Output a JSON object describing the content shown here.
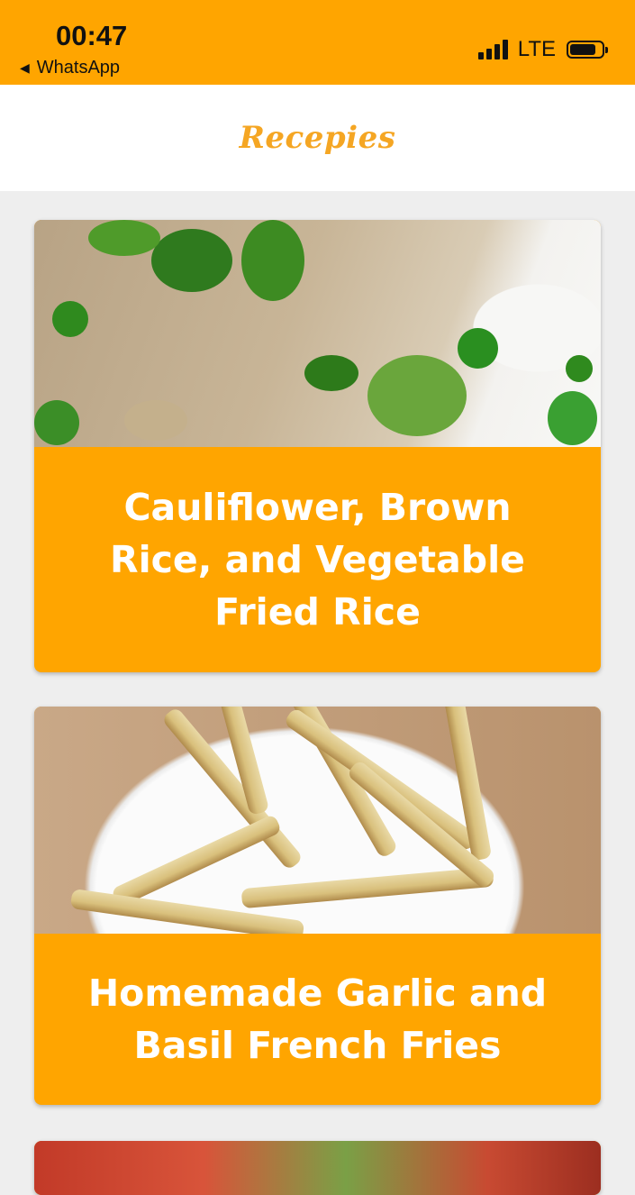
{
  "status_bar": {
    "time": "00:47",
    "back_app": "WhatsApp",
    "network": "LTE",
    "back_icon": "back-triangle-icon",
    "signal_icon": "signal-bars-icon",
    "battery_icon": "battery-icon"
  },
  "header": {
    "title": "Recepies",
    "color": "#f5a623"
  },
  "colors": {
    "accent": "#ffa500",
    "background": "#eeeeee"
  },
  "recipes": [
    {
      "title": "Cauliflower, Brown Rice, and Vegetable Fried Rice",
      "image": "fried-rice-photo"
    },
    {
      "title": "Homemade Garlic and Basil French Fries",
      "image": "french-fries-photo"
    },
    {
      "title": "",
      "image": "tomato-dish-photo"
    }
  ]
}
